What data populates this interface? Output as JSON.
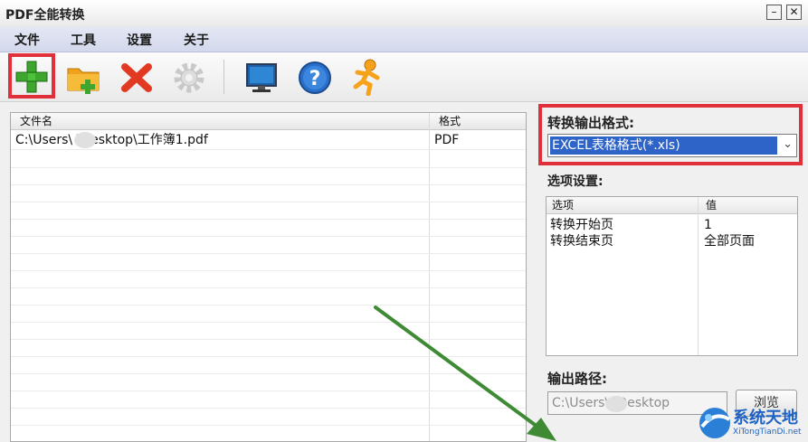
{
  "window": {
    "title": "PDF全能转换"
  },
  "menu": {
    "items": [
      "文件",
      "工具",
      "设置",
      "关于"
    ]
  },
  "toolbar": {
    "icons": [
      "add-file-icon",
      "add-folder-icon",
      "delete-icon",
      "settings-gear-icon",
      "monitor-icon",
      "help-icon",
      "run-person-icon"
    ],
    "highlight_color": "#e1303a"
  },
  "file_list": {
    "columns": [
      "文件名",
      "格式"
    ],
    "rows": [
      {
        "name": "C:\\Users\\  \\Desktop\\工作簿1.pdf",
        "format": "PDF"
      }
    ]
  },
  "output_format": {
    "label": "转换输出格式:",
    "selected": "EXCEL表格格式(*.xls)"
  },
  "options": {
    "label": "选项设置:",
    "columns": [
      "选项",
      "值"
    ],
    "rows": [
      {
        "option": "转换开始页",
        "value": "1"
      },
      {
        "option": "转换结束页",
        "value": "全部页面"
      }
    ]
  },
  "output_path": {
    "label": "输出路径:",
    "value": "C:\\Users\\  \\Desktop",
    "browse_label": "浏览"
  },
  "watermark": {
    "text": "系统天地",
    "url": "XiTongTianDi.net"
  },
  "colors": {
    "accent_select": "#2e63c8",
    "arrow": "#3e8a35"
  }
}
